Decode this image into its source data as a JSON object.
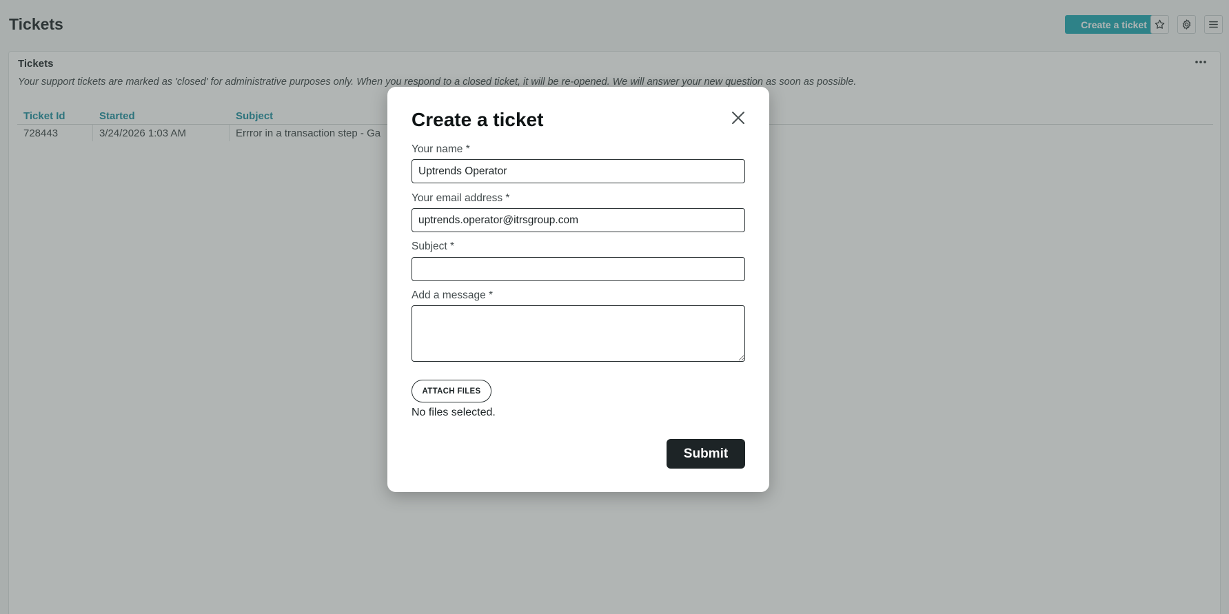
{
  "header": {
    "title": "Tickets",
    "create_button": "Create a ticket",
    "favorite_icon": "star-icon",
    "settings_icon": "gear-icon",
    "menu_icon": "hamburger-menu-icon"
  },
  "card": {
    "title": "Tickets",
    "menu_icon": "more-horizontal-icon",
    "note": "Your support tickets are marked as 'closed' for administrative purposes only. When you respond to a closed ticket, it will be re-opened. We will answer your new question as soon as possible.",
    "table": {
      "columns": [
        "Ticket Id",
        "Started",
        "Subject"
      ],
      "rows": [
        [
          "728443",
          "3/24/2026 1:03 AM",
          "Errror in a transaction step - Ga"
        ]
      ]
    }
  },
  "modal": {
    "title": "Create a ticket",
    "close_icon": "close-icon",
    "fields": {
      "name": {
        "label": "Your name *",
        "value": "Uptrends Operator"
      },
      "email": {
        "label": "Your email address *",
        "value": "uptrends.operator@itrsgroup.com"
      },
      "subject": {
        "label": "Subject *",
        "value": ""
      },
      "message": {
        "label": "Add a message *",
        "value": ""
      }
    },
    "attach_label": "ATTACH FILES",
    "files_status": "No files selected.",
    "submit_label": "Submit"
  },
  "colors": {
    "accent": "#1ea7b4",
    "link": "#1e8fa1",
    "dark_button": "#1d2426"
  }
}
